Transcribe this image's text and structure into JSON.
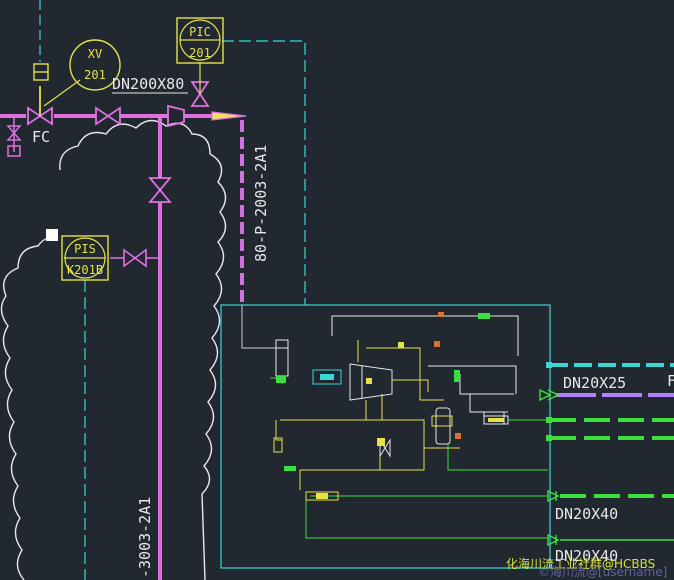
{
  "instruments": {
    "xv": {
      "tag": "XV",
      "number": "201"
    },
    "pic": {
      "tag": "PIC",
      "number": "201"
    },
    "pis": {
      "tag": "PIS",
      "number": "K201B"
    }
  },
  "labels": {
    "fail_action": "FC",
    "reducer_size": "DN200X80",
    "line_number": "80-P-2003-2A1",
    "line_number_lower": "-3003-2A1",
    "outlet_1": "DN20X25",
    "outlet_1_cut": "F",
    "outlet_2": "DN20X40",
    "outlet_3": "DN20X40"
  },
  "watermark": {
    "primary": "化海川流工业社群@HCBBS",
    "secondary": "©海川流@[username]"
  },
  "colors": {
    "background": "#212830",
    "process_line": "#e070e0",
    "instrument": "#e6e04a",
    "signal_line": "#38d8d8",
    "cloud": "#e8e8e8",
    "utility_green": "#3ce03c",
    "utility_lavender": "#b080ff"
  }
}
